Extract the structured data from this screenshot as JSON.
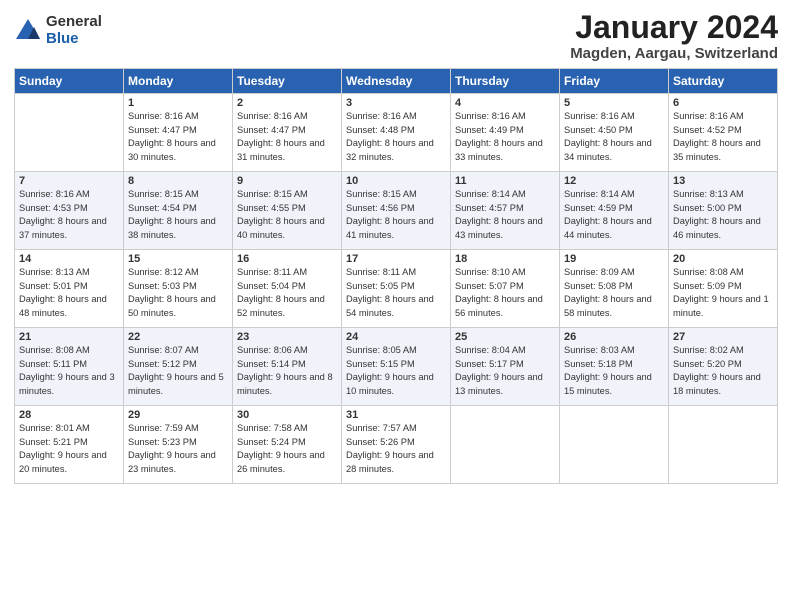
{
  "logo": {
    "general": "General",
    "blue": "Blue"
  },
  "title": "January 2024",
  "location": "Magden, Aargau, Switzerland",
  "weekdays": [
    "Sunday",
    "Monday",
    "Tuesday",
    "Wednesday",
    "Thursday",
    "Friday",
    "Saturday"
  ],
  "weeks": [
    [
      {
        "day": "",
        "sunrise": "",
        "sunset": "",
        "daylight": ""
      },
      {
        "day": "1",
        "sunrise": "Sunrise: 8:16 AM",
        "sunset": "Sunset: 4:47 PM",
        "daylight": "Daylight: 8 hours and 30 minutes."
      },
      {
        "day": "2",
        "sunrise": "Sunrise: 8:16 AM",
        "sunset": "Sunset: 4:47 PM",
        "daylight": "Daylight: 8 hours and 31 minutes."
      },
      {
        "day": "3",
        "sunrise": "Sunrise: 8:16 AM",
        "sunset": "Sunset: 4:48 PM",
        "daylight": "Daylight: 8 hours and 32 minutes."
      },
      {
        "day": "4",
        "sunrise": "Sunrise: 8:16 AM",
        "sunset": "Sunset: 4:49 PM",
        "daylight": "Daylight: 8 hours and 33 minutes."
      },
      {
        "day": "5",
        "sunrise": "Sunrise: 8:16 AM",
        "sunset": "Sunset: 4:50 PM",
        "daylight": "Daylight: 8 hours and 34 minutes."
      },
      {
        "day": "6",
        "sunrise": "Sunrise: 8:16 AM",
        "sunset": "Sunset: 4:52 PM",
        "daylight": "Daylight: 8 hours and 35 minutes."
      }
    ],
    [
      {
        "day": "7",
        "sunrise": "Sunrise: 8:16 AM",
        "sunset": "Sunset: 4:53 PM",
        "daylight": "Daylight: 8 hours and 37 minutes."
      },
      {
        "day": "8",
        "sunrise": "Sunrise: 8:15 AM",
        "sunset": "Sunset: 4:54 PM",
        "daylight": "Daylight: 8 hours and 38 minutes."
      },
      {
        "day": "9",
        "sunrise": "Sunrise: 8:15 AM",
        "sunset": "Sunset: 4:55 PM",
        "daylight": "Daylight: 8 hours and 40 minutes."
      },
      {
        "day": "10",
        "sunrise": "Sunrise: 8:15 AM",
        "sunset": "Sunset: 4:56 PM",
        "daylight": "Daylight: 8 hours and 41 minutes."
      },
      {
        "day": "11",
        "sunrise": "Sunrise: 8:14 AM",
        "sunset": "Sunset: 4:57 PM",
        "daylight": "Daylight: 8 hours and 43 minutes."
      },
      {
        "day": "12",
        "sunrise": "Sunrise: 8:14 AM",
        "sunset": "Sunset: 4:59 PM",
        "daylight": "Daylight: 8 hours and 44 minutes."
      },
      {
        "day": "13",
        "sunrise": "Sunrise: 8:13 AM",
        "sunset": "Sunset: 5:00 PM",
        "daylight": "Daylight: 8 hours and 46 minutes."
      }
    ],
    [
      {
        "day": "14",
        "sunrise": "Sunrise: 8:13 AM",
        "sunset": "Sunset: 5:01 PM",
        "daylight": "Daylight: 8 hours and 48 minutes."
      },
      {
        "day": "15",
        "sunrise": "Sunrise: 8:12 AM",
        "sunset": "Sunset: 5:03 PM",
        "daylight": "Daylight: 8 hours and 50 minutes."
      },
      {
        "day": "16",
        "sunrise": "Sunrise: 8:11 AM",
        "sunset": "Sunset: 5:04 PM",
        "daylight": "Daylight: 8 hours and 52 minutes."
      },
      {
        "day": "17",
        "sunrise": "Sunrise: 8:11 AM",
        "sunset": "Sunset: 5:05 PM",
        "daylight": "Daylight: 8 hours and 54 minutes."
      },
      {
        "day": "18",
        "sunrise": "Sunrise: 8:10 AM",
        "sunset": "Sunset: 5:07 PM",
        "daylight": "Daylight: 8 hours and 56 minutes."
      },
      {
        "day": "19",
        "sunrise": "Sunrise: 8:09 AM",
        "sunset": "Sunset: 5:08 PM",
        "daylight": "Daylight: 8 hours and 58 minutes."
      },
      {
        "day": "20",
        "sunrise": "Sunrise: 8:08 AM",
        "sunset": "Sunset: 5:09 PM",
        "daylight": "Daylight: 9 hours and 1 minute."
      }
    ],
    [
      {
        "day": "21",
        "sunrise": "Sunrise: 8:08 AM",
        "sunset": "Sunset: 5:11 PM",
        "daylight": "Daylight: 9 hours and 3 minutes."
      },
      {
        "day": "22",
        "sunrise": "Sunrise: 8:07 AM",
        "sunset": "Sunset: 5:12 PM",
        "daylight": "Daylight: 9 hours and 5 minutes."
      },
      {
        "day": "23",
        "sunrise": "Sunrise: 8:06 AM",
        "sunset": "Sunset: 5:14 PM",
        "daylight": "Daylight: 9 hours and 8 minutes."
      },
      {
        "day": "24",
        "sunrise": "Sunrise: 8:05 AM",
        "sunset": "Sunset: 5:15 PM",
        "daylight": "Daylight: 9 hours and 10 minutes."
      },
      {
        "day": "25",
        "sunrise": "Sunrise: 8:04 AM",
        "sunset": "Sunset: 5:17 PM",
        "daylight": "Daylight: 9 hours and 13 minutes."
      },
      {
        "day": "26",
        "sunrise": "Sunrise: 8:03 AM",
        "sunset": "Sunset: 5:18 PM",
        "daylight": "Daylight: 9 hours and 15 minutes."
      },
      {
        "day": "27",
        "sunrise": "Sunrise: 8:02 AM",
        "sunset": "Sunset: 5:20 PM",
        "daylight": "Daylight: 9 hours and 18 minutes."
      }
    ],
    [
      {
        "day": "28",
        "sunrise": "Sunrise: 8:01 AM",
        "sunset": "Sunset: 5:21 PM",
        "daylight": "Daylight: 9 hours and 20 minutes."
      },
      {
        "day": "29",
        "sunrise": "Sunrise: 7:59 AM",
        "sunset": "Sunset: 5:23 PM",
        "daylight": "Daylight: 9 hours and 23 minutes."
      },
      {
        "day": "30",
        "sunrise": "Sunrise: 7:58 AM",
        "sunset": "Sunset: 5:24 PM",
        "daylight": "Daylight: 9 hours and 26 minutes."
      },
      {
        "day": "31",
        "sunrise": "Sunrise: 7:57 AM",
        "sunset": "Sunset: 5:26 PM",
        "daylight": "Daylight: 9 hours and 28 minutes."
      },
      {
        "day": "",
        "sunrise": "",
        "sunset": "",
        "daylight": ""
      },
      {
        "day": "",
        "sunrise": "",
        "sunset": "",
        "daylight": ""
      },
      {
        "day": "",
        "sunrise": "",
        "sunset": "",
        "daylight": ""
      }
    ]
  ]
}
